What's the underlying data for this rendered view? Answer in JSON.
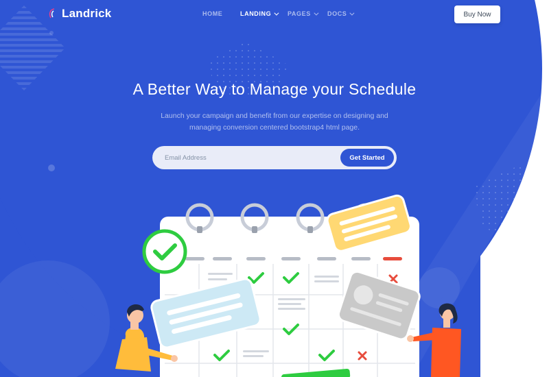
{
  "brand": {
    "name": "Landrick"
  },
  "nav": {
    "items": [
      {
        "label": "HOME",
        "active": false,
        "dropdown": false
      },
      {
        "label": "LANDING",
        "active": true,
        "dropdown": true
      },
      {
        "label": "PAGES",
        "active": false,
        "dropdown": true
      },
      {
        "label": "DOCS",
        "active": false,
        "dropdown": true
      }
    ],
    "cta_label": "Buy Now"
  },
  "hero": {
    "title": "A Better Way to Manage your Schedule",
    "subtitle_line1": "Launch your campaign and benefit from our expertise on designing and",
    "subtitle_line2": "managing conversion centered bootstrap4 html page.",
    "email_placeholder": "Email Address",
    "submit_label": "Get Started"
  },
  "colors": {
    "primary": "#2f55d4",
    "check_green": "#2ecc40",
    "cross_red": "#e74c3c",
    "card_blue": "#cde9f5",
    "card_yellow": "#ffd873",
    "card_gray": "#c9c9c9"
  },
  "icons": [
    "logo-icon",
    "chevron-down-icon",
    "check-icon",
    "cross-icon"
  ]
}
